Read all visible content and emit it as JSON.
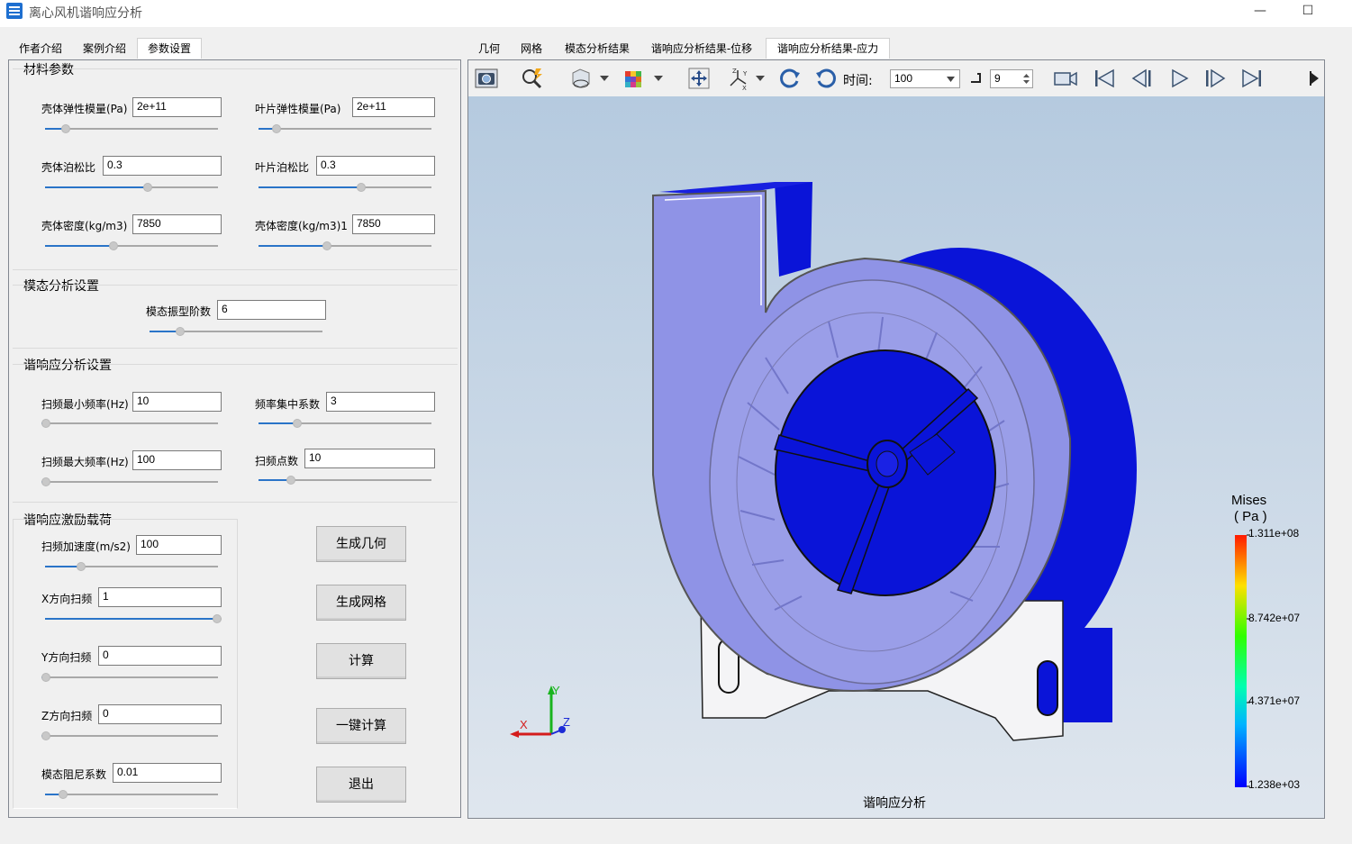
{
  "window": {
    "title": "离心风机谐响应分析",
    "minimize": "—",
    "maximize": "☐"
  },
  "left_tabs": [
    {
      "label": "作者介绍"
    },
    {
      "label": "案例介绍"
    },
    {
      "label": "参数设置",
      "active": true
    }
  ],
  "right_tabs": [
    {
      "label": "几何"
    },
    {
      "label": "网格"
    },
    {
      "label": "模态分析结果"
    },
    {
      "label": "谐响应分析结果-位移"
    },
    {
      "label": "谐响应分析结果-应力",
      "active": true
    }
  ],
  "material": {
    "title": "材料参数",
    "shell_modulus": {
      "label": "壳体弹性模量(Pa)",
      "value": "2e+11",
      "slider": 0.1
    },
    "blade_modulus": {
      "label": "叶片弹性模量(Pa)",
      "value": "2e+11",
      "slider": 0.08
    },
    "shell_poisson": {
      "label": "壳体泊松比",
      "value": "0.3",
      "slider": 0.6
    },
    "blade_poisson": {
      "label": "叶片泊松比",
      "value": "0.3",
      "slider": 0.6
    },
    "shell_density": {
      "label": "壳体密度(kg/m3)",
      "value": "7850",
      "slider": 0.39
    },
    "shell_density1": {
      "label": "壳体密度(kg/m3)1",
      "value": "7850",
      "slider": 0.39
    }
  },
  "modal": {
    "title": "模态分析设置",
    "modes": {
      "label": "模态振型阶数",
      "value": "6",
      "slider": 0.16
    }
  },
  "harmonic": {
    "title": "谐响应分析设置",
    "fmin": {
      "label": "扫频最小频率(Hz)",
      "value": "10",
      "slider": 0.0
    },
    "conc": {
      "label": "频率集中系数",
      "value": "3",
      "slider": 0.21
    },
    "fmax": {
      "label": "扫频最大频率(Hz)",
      "value": "100",
      "slider": 0.0
    },
    "points": {
      "label": "扫频点数",
      "value": "10",
      "slider": 0.17
    }
  },
  "excitation": {
    "title": "谐响应激励载荷",
    "accel": {
      "label": "扫频加速度(m/s2)",
      "value": "100",
      "slider": 0.19
    },
    "x": {
      "label": "X方向扫频",
      "value": "1",
      "slider": 1.0
    },
    "y": {
      "label": "Y方向扫频",
      "value": "0",
      "slider": 0.0
    },
    "z": {
      "label": "Z方向扫频",
      "value": "0",
      "slider": 0.0
    },
    "damping": {
      "label": "模态阻尼系数",
      "value": "0.01",
      "slider": 0.08
    }
  },
  "buttons": {
    "gen_geometry": "生成几何",
    "gen_mesh": "生成网格",
    "compute": "计算",
    "one_click": "一键计算",
    "exit": "退出"
  },
  "toolbar": {
    "time_label": "时间:",
    "time_value": "100",
    "step_value": "9"
  },
  "viewer": {
    "caption": "谐响应分析",
    "legend": {
      "title_line1": "Mises",
      "title_line2": "( Pa )",
      "max": "1.311e+08",
      "v2": "8.742e+07",
      "v3": "4.371e+07",
      "min": "1.238e+03"
    },
    "axes": {
      "x": "X",
      "y": "Y",
      "z": "Z"
    }
  },
  "colors": {
    "accent": "#2a74c8",
    "model_blue": "#0a14d8",
    "model_shell": "#8f93e6"
  }
}
